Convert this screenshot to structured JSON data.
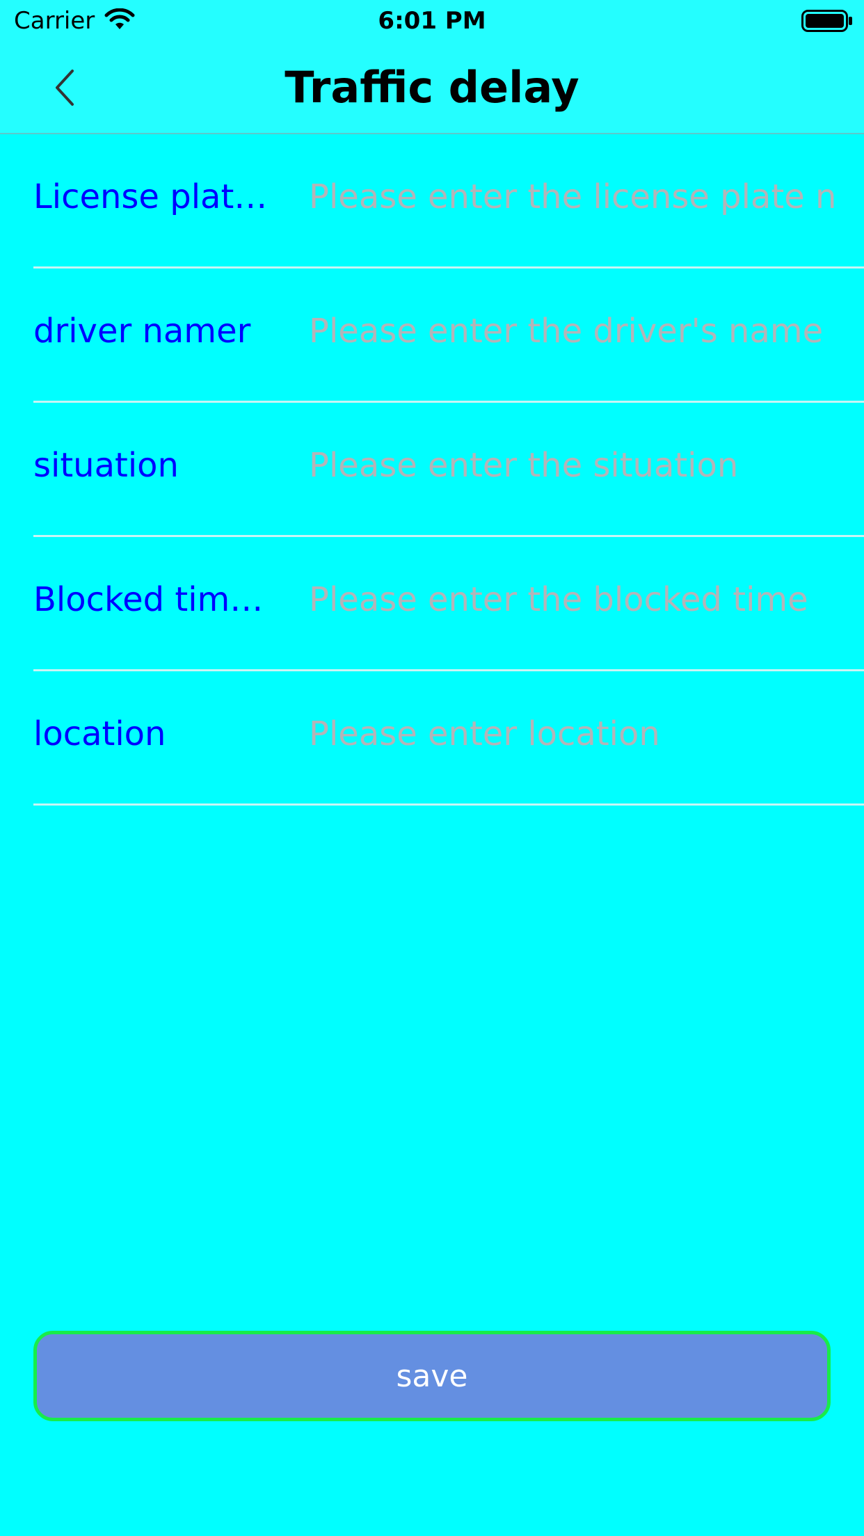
{
  "status_bar": {
    "carrier": "Carrier",
    "time": "6:01 PM",
    "wifi_icon": "wifi-icon",
    "battery_icon": "battery-full-icon"
  },
  "nav": {
    "title": "Traffic delay",
    "back_icon": "chevron-left-icon"
  },
  "form": {
    "rows": [
      {
        "label": "License plat…",
        "placeholder": "Please enter the license plate n",
        "value": ""
      },
      {
        "label": "driver namer",
        "placeholder": "Please enter the driver's name",
        "value": ""
      },
      {
        "label": "situation",
        "placeholder": "Please enter the situation",
        "value": ""
      },
      {
        "label": "Blocked tim…",
        "placeholder": "Please enter the blocked time",
        "value": ""
      },
      {
        "label": "location",
        "placeholder": "Please enter location",
        "value": ""
      }
    ]
  },
  "save_button": {
    "label": "save"
  },
  "colors": {
    "background": "#00FFFF",
    "bar_background": "#24FEFF",
    "label_color": "#0000FF",
    "placeholder_color": "#B4B4B8",
    "button_fill": "#648FE1",
    "button_border": "#18EC4A",
    "separator": "#C8F5F5"
  }
}
